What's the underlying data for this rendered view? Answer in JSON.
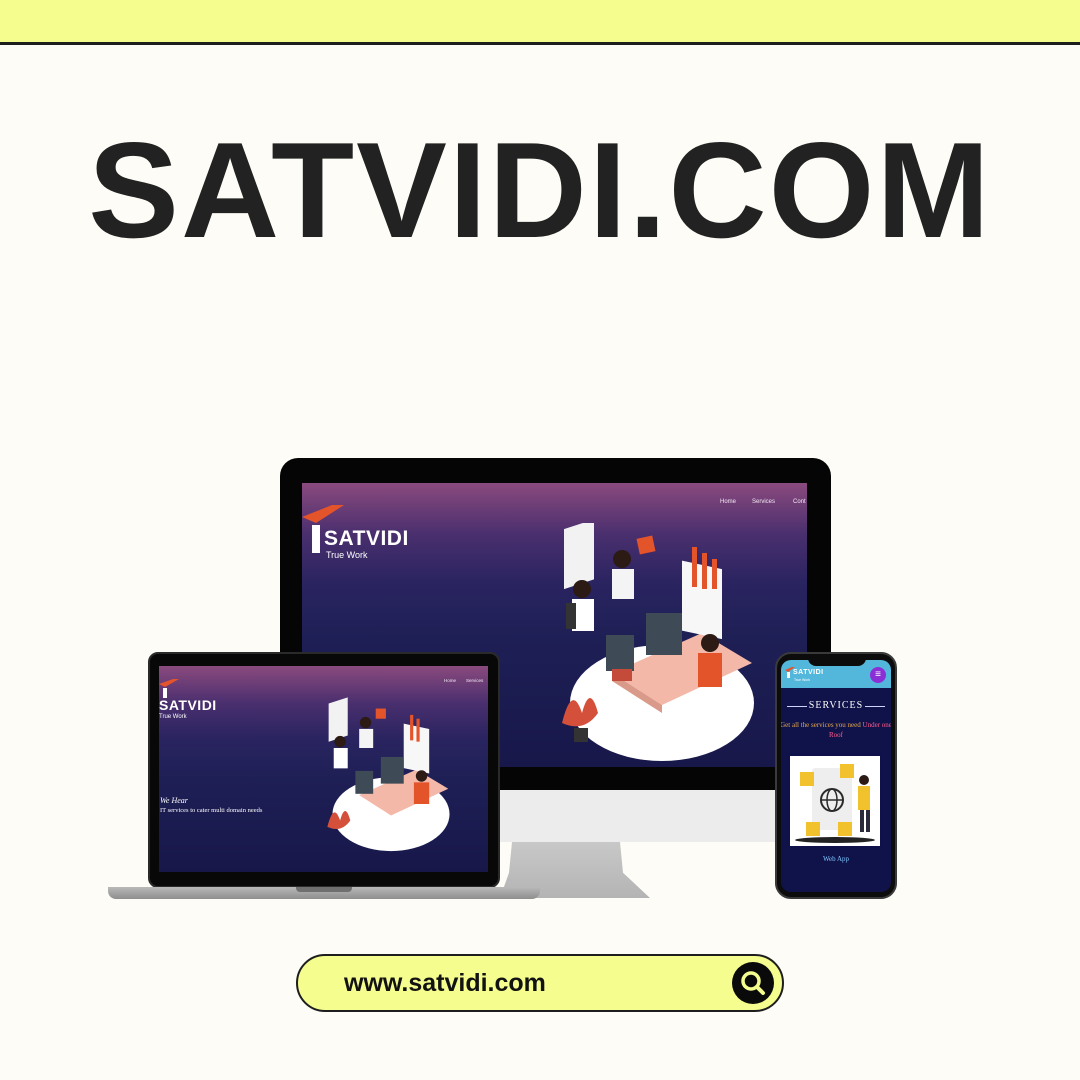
{
  "banner": {
    "title": "SATVIDI.COM"
  },
  "monitor": {
    "nav": [
      "Home",
      "Services",
      "Cont"
    ],
    "brand": {
      "name": "SATVIDI",
      "tagline": "True Work"
    }
  },
  "laptop": {
    "nav": [
      "Home",
      "Services"
    ],
    "brand": {
      "name": "SATVIDI",
      "tagline": "True Work"
    },
    "hero": {
      "heading": "We Hear",
      "text": "IT services to cater multi domain needs"
    }
  },
  "phone": {
    "brand": {
      "name": "SATVIDI",
      "tagline": "True Work"
    },
    "menu_icon": "hamburger-icon",
    "section_title": "SERVICES",
    "subtitle_lead": "Get all the services you need ",
    "subtitle_highlight": "Under one Roof",
    "card_label": "Web App"
  },
  "search": {
    "url": "www.satvidi.com",
    "icon": "search-icon"
  },
  "colors": {
    "accent_yellow": "#f4fd8e",
    "title_dark": "#222222",
    "phone_header": "#53b7dc",
    "brand_orange": "#e4542a"
  }
}
